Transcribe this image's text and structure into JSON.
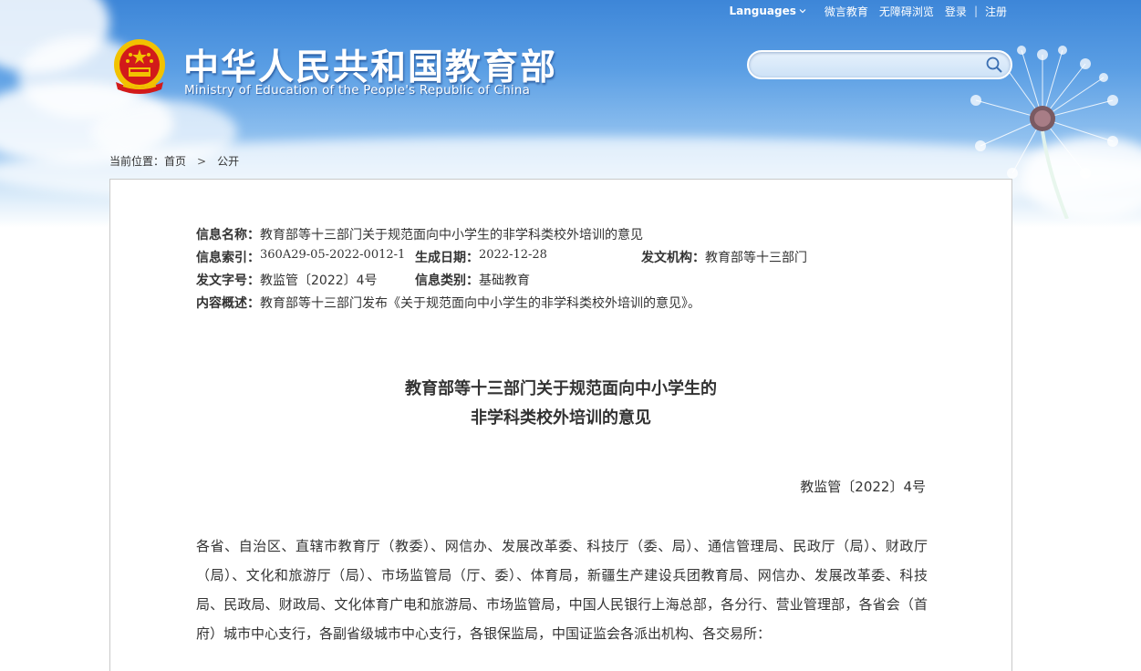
{
  "header": {
    "title": "中华人民共和国教育部",
    "subtitle": "Ministry of Education of the People's Republic of China",
    "languages_label": "Languages",
    "links": [
      "微言教育",
      "无障碍浏览",
      "登录",
      "注册"
    ],
    "search_placeholder": ""
  },
  "breadcrumb": {
    "prefix": "当前位置：",
    "home": "首页",
    "arrow": ">",
    "current": "公开"
  },
  "meta": {
    "name_label": "信息名称：",
    "name_value": "教育部等十三部门关于规范面向中小学生的非学科类校外培训的意见",
    "index_label": "信息索引：",
    "index_value": "360A29-05-2022-0012-1",
    "date_label": "生成日期：",
    "date_value": "2022-12-28",
    "org_label": "发文机构：",
    "org_value": "教育部等十三部门",
    "docno_label": "发文字号：",
    "docno_value": "教监管〔2022〕4号",
    "category_label": "信息类别：",
    "category_value": "基础教育",
    "summary_label": "内容概述：",
    "summary_value": "教育部等十三部门发布《关于规范面向中小学生的非学科类校外培训的意见》。"
  },
  "document": {
    "title_line1": "教育部等十三部门关于规范面向中小学生的",
    "title_line2": "非学科类校外培训的意见",
    "doc_number": "教监管〔2022〕4号",
    "body": "各省、自治区、直辖市教育厅（教委）、网信办、发展改革委、科技厅（委、局）、通信管理局、民政厅（局）、财政厅（局）、文化和旅游厅（局）、市场监管局（厅、委）、体育局，新疆生产建设兵团教育局、网信办、发展改革委、科技局、民政局、财政局、文化体育广电和旅游局、市场监管局，中国人民银行上海总部，各分行、营业管理部，各省会（首府）城市中心支行，各副省级城市中心支行，各银保监局，中国证监会各派出机构、各交易所："
  },
  "colors": {
    "sky_top": "#3d86d8",
    "emblem_red": "#d21a1a",
    "emblem_gold": "#f2c200",
    "text": "#333333"
  }
}
